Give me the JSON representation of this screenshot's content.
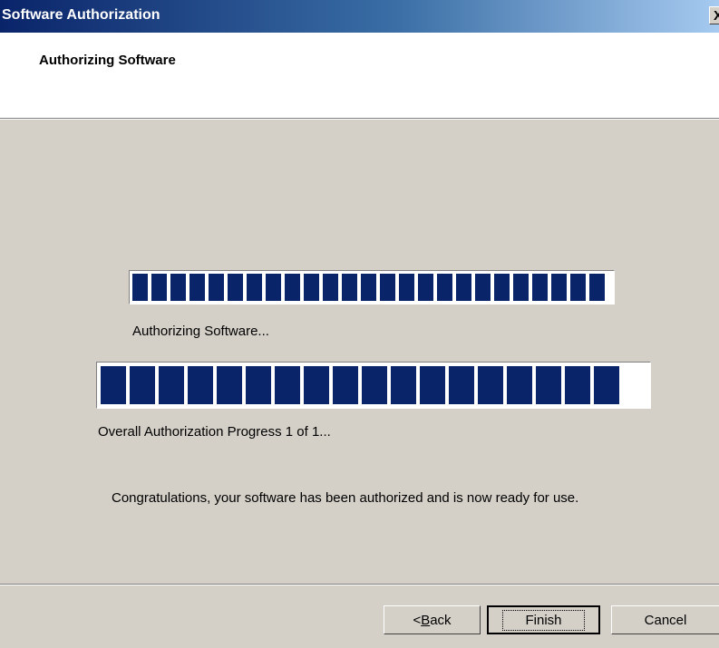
{
  "window": {
    "title": "Software Authorization",
    "close_glyph": "X",
    "subtitle": "Authorizing Software"
  },
  "progress": {
    "current_label": "Authorizing Software...",
    "current_value": 1.0,
    "overall_label": "Overall Authorization Progress 1 of 1...",
    "overall_value": 1.0,
    "fill_color": "#0a246a"
  },
  "message": "Congratulations, your software has been authorized and is now ready for use.",
  "buttons": {
    "back_prefix": "< ",
    "back_mnemonic": "B",
    "back_rest": "ack",
    "finish": "Finish",
    "cancel": "Cancel"
  }
}
